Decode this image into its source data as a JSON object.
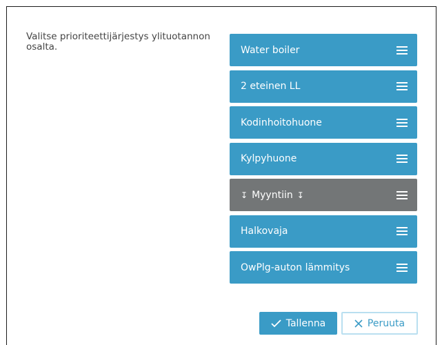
{
  "dialog": {
    "instruction": "Valitse prioriteettijärjestys ylituotannon osalta."
  },
  "priority_list": {
    "items": [
      {
        "label": "Water boiler"
      },
      {
        "label": "2 eteinen LL"
      },
      {
        "label": "Kodinhoitohuone"
      },
      {
        "label": "Kylpyhuone"
      },
      {
        "label": "Myyntiin",
        "type": "divider"
      },
      {
        "label": "Halkovaja"
      },
      {
        "label": "OwPlg-auton lämmitys"
      }
    ]
  },
  "buttons": {
    "save_label": "Tallenna",
    "cancel_label": "Peruuta"
  },
  "colors": {
    "item_bg": "#3a9bc6",
    "divider_bg": "#737677",
    "cancel_border": "#b9dff0"
  }
}
